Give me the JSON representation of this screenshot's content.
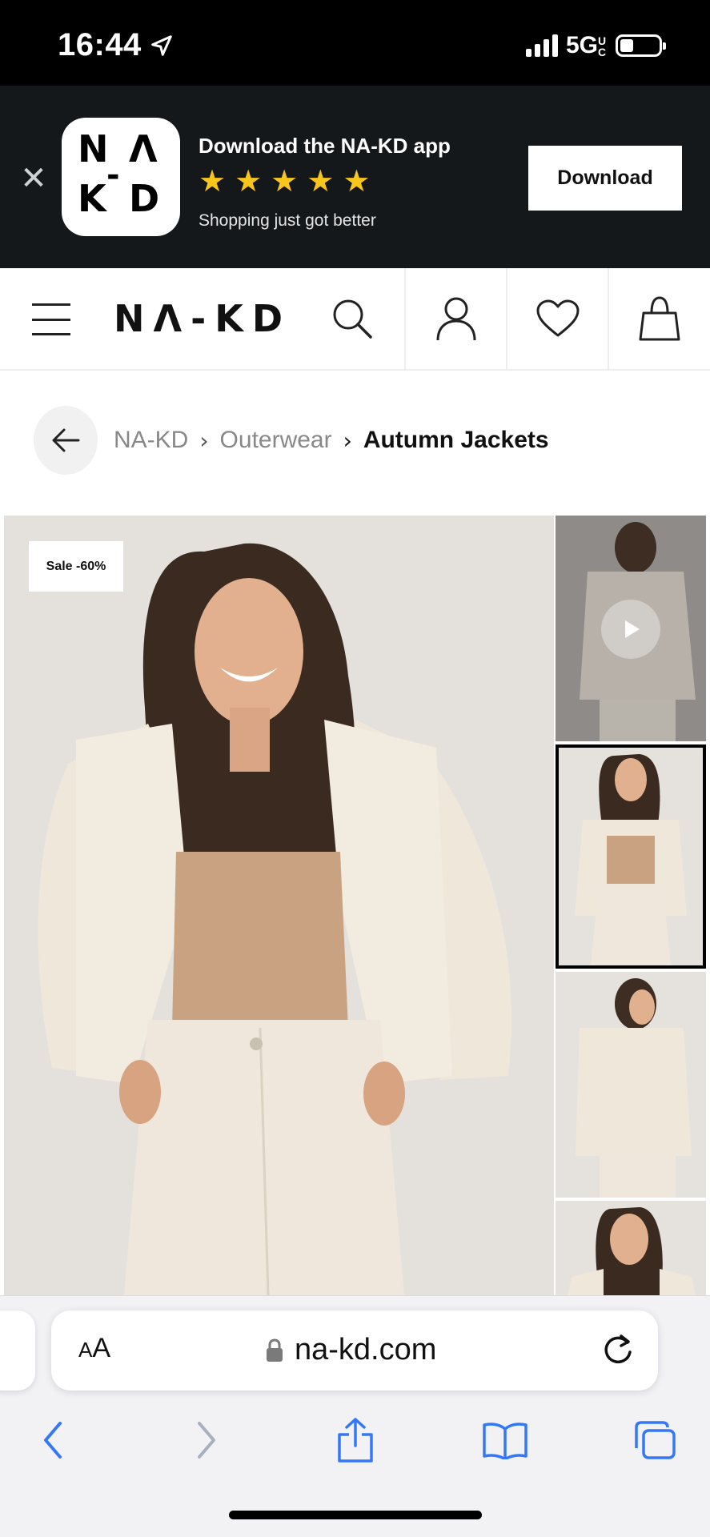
{
  "status_bar": {
    "time": "16:44",
    "network": "5G",
    "network_sub": "UC",
    "battery_level": 0.35
  },
  "app_banner": {
    "title": "Download the NA-KD app",
    "rating_stars": 5,
    "subtitle": "Shopping just got better",
    "download_label": "Download",
    "close_icon": "close-icon",
    "star_color": "#f8c51c",
    "background_color": "#15181b"
  },
  "header": {
    "brand": "NA-KD",
    "icons": [
      "hamburger-menu-icon",
      "search-icon",
      "account-icon",
      "wishlist-heart-icon",
      "shopping-bag-icon"
    ]
  },
  "breadcrumb": {
    "items": [
      "NA-KD",
      "Outerwear"
    ],
    "current": "Autumn Jackets"
  },
  "product_gallery": {
    "sale_badge": "Sale -60%",
    "thumbnails": [
      {
        "kind": "video",
        "state": "default"
      },
      {
        "kind": "image",
        "state": "selected"
      },
      {
        "kind": "image",
        "state": "default"
      },
      {
        "kind": "image",
        "state": "default"
      }
    ]
  },
  "browser": {
    "text_size_label": "AA",
    "url": "na-kd.com",
    "toolbar_icons": [
      "back-arrow-icon",
      "forward-arrow-icon",
      "share-icon",
      "bookmarks-icon",
      "tabs-icon"
    ],
    "accent_color": "#3478f6"
  }
}
